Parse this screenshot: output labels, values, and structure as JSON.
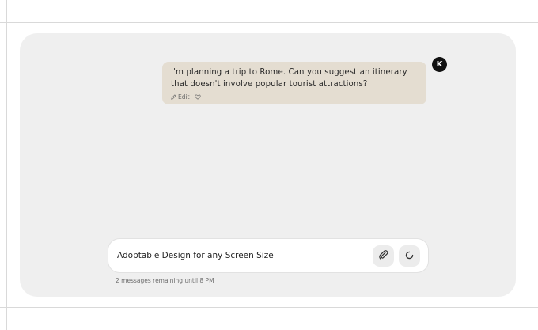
{
  "chat": {
    "user_message": "I'm planning a trip to Rome. Can you suggest an itinerary that doesn't involve popular tourist attractions?",
    "edit_label": "Edit",
    "avatar_initial": "K"
  },
  "composer": {
    "input_value": "Adoptable Design for any Screen Size",
    "remaining_text": "2 messages remaining until 8 PM"
  },
  "icons": {
    "edit": "pencil-icon",
    "like": "heart-icon",
    "attach": "paperclip-icon",
    "refresh": "refresh-icon"
  },
  "colors": {
    "card_bg": "#efefef",
    "bubble_bg": "#e4ddd1",
    "avatar_bg": "#111111"
  }
}
